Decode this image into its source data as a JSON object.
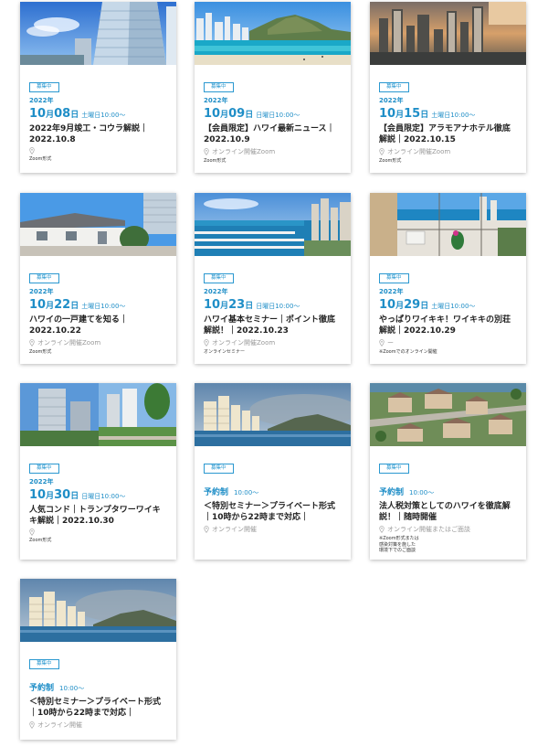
{
  "cards": [
    {
      "badge": "募集中",
      "year": "2022年",
      "month": "10",
      "day": "08",
      "time": "土曜日10:00〜",
      "title": "2022年9月竣工・コウラ解説｜2022.10.8",
      "place": "",
      "format": "Zoom形式"
    },
    {
      "badge": "募集中",
      "year": "2022年",
      "month": "10",
      "day": "09",
      "time": "日曜日10:00〜",
      "title": "【会員限定】ハワイ最新ニュース｜2022.10.9",
      "place": "オンライン開催Zoom",
      "format": "Zoom形式"
    },
    {
      "badge": "募集中",
      "year": "2022年",
      "month": "10",
      "day": "15",
      "time": "土曜日10:00〜",
      "title": "【会員限定】アラモアナホテル徹底解説｜2022.10.15",
      "place": "オンライン開催Zoom",
      "format": "Zoom形式"
    },
    {
      "badge": "募集中",
      "year": "2022年",
      "month": "10",
      "day": "22",
      "time": "土曜日10:00〜",
      "title": "ハワイの一戸建てを知る｜2022.10.22",
      "place": "オンライン開催Zoom",
      "format": "Zoom形式"
    },
    {
      "badge": "募集中",
      "year": "2022年",
      "month": "10",
      "day": "23",
      "time": "日曜日10:00〜",
      "title": "ハワイ基本セミナー｜ポイント徹底解説！｜2022.10.23",
      "place": "オンライン開催Zoom",
      "format": "オンラインセミナー"
    },
    {
      "badge": "募集中",
      "year": "2022年",
      "month": "10",
      "day": "29",
      "time": "土曜日10:00〜",
      "title": "やっぱりワイキキ！ワイキキの別荘解説｜2022.10.29",
      "place": "ー",
      "format": "※Zoomでのオンライン開催"
    },
    {
      "badge": "募集中",
      "year": "2022年",
      "month": "10",
      "day": "30",
      "time": "日曜日10:00〜",
      "title": "人気コンド｜トランプタワーワイキキ解説｜2022.10.30",
      "place": "",
      "format": "Zoom形式"
    },
    {
      "badge": "募集中",
      "reserve": "予約制",
      "time": "10:00〜",
      "title": "＜特別セミナー＞プライベート形式｜10時から22時まで対応｜",
      "place": "オンライン開催",
      "format": ""
    },
    {
      "badge": "募集中",
      "reserve": "予約制",
      "time": "10:00〜",
      "title": "法人税対策としてのハワイを徹底解説！｜随時開催",
      "place": "オンライン開催またはご面談",
      "format": "※Zoom形式または\n感染対策を施した\n環境下でのご面談"
    },
    {
      "badge": "募集中",
      "reserve": "予約制",
      "time": "10:00〜",
      "title": "＜特別セミナー＞プライベート形式｜10時から22時まで対応｜",
      "place": "オンライン開催",
      "format": ""
    }
  ],
  "month_unit": "月",
  "day_unit": "日"
}
